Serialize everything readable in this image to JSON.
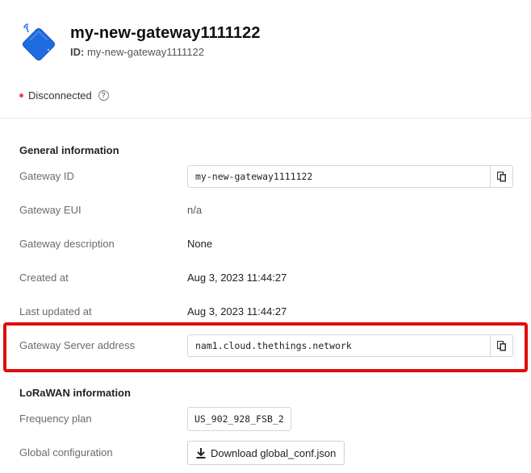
{
  "gateway": {
    "name": "my-new-gateway1111122",
    "id_label": "ID:",
    "id_value": "my-new-gateway1111122"
  },
  "status": {
    "text": "Disconnected",
    "dot_color": "#e5484d",
    "help_glyph": "?"
  },
  "general": {
    "title": "General information",
    "rows": {
      "gateway_id": {
        "label": "Gateway ID",
        "value": "my-new-gateway1111122"
      },
      "gateway_eui": {
        "label": "Gateway EUI",
        "value": "n/a"
      },
      "description": {
        "label": "Gateway description",
        "value": "None"
      },
      "created_at": {
        "label": "Created at",
        "value": "Aug 3, 2023 11:44:27"
      },
      "updated_at": {
        "label": "Last updated at",
        "value": "Aug 3, 2023 11:44:27"
      },
      "server_address": {
        "label": "Gateway Server address",
        "value": "nam1.cloud.thethings.network"
      }
    }
  },
  "lorawan": {
    "title": "LoRaWAN information",
    "frequency_plan": {
      "label": "Frequency plan",
      "value": "US_902_928_FSB_2"
    },
    "global_config": {
      "label": "Global configuration",
      "button": "Download global_conf.json"
    }
  },
  "icons": {
    "gateway": "gateway-icon",
    "copy": "copy-icon",
    "download": "download-icon",
    "help": "help-icon"
  },
  "colors": {
    "highlight": "#e00c0c",
    "gateway_blue": "#1f6be0"
  }
}
